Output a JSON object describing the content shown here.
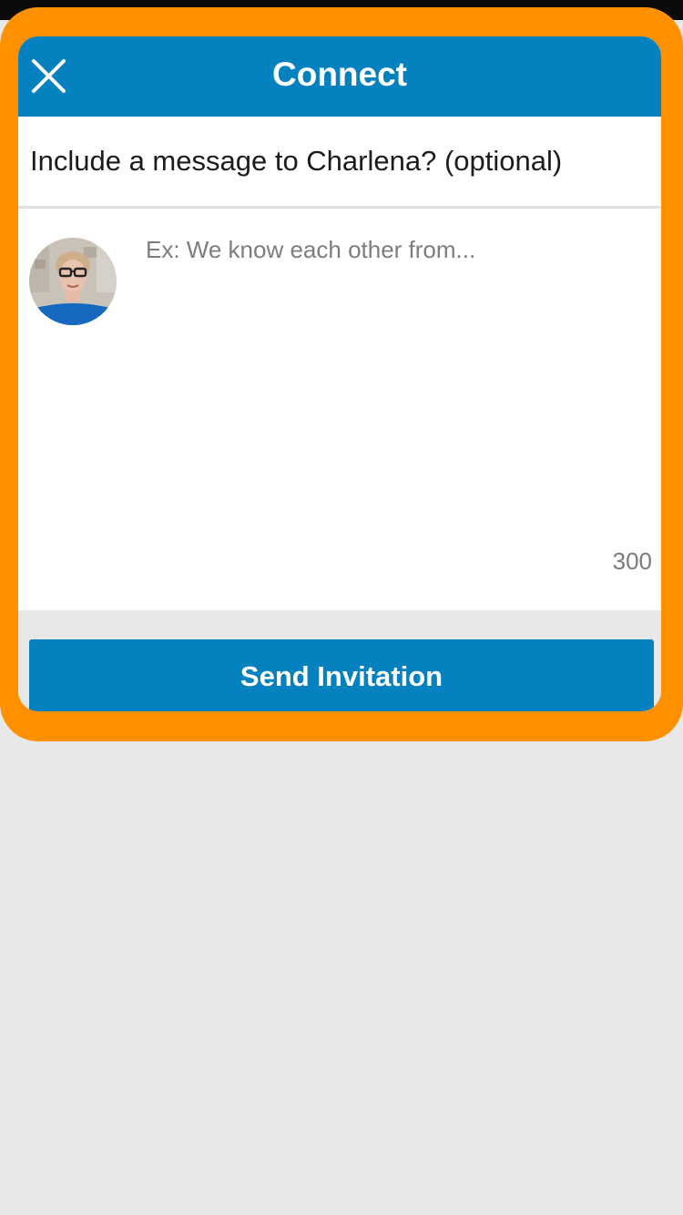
{
  "dialog": {
    "title": "Connect",
    "close_icon": "close-icon",
    "prompt": "Include a message to Charlena? (optional)",
    "message": {
      "placeholder": "Ex: We know each other from...",
      "value": "",
      "remaining_chars": "300"
    },
    "recipient_avatar": "avatar-photo",
    "send_label": "Send Invitation"
  },
  "colors": {
    "brand_blue": "#0581c0",
    "highlight_orange": "#ff9100",
    "background_gray": "#e8e8e9"
  }
}
